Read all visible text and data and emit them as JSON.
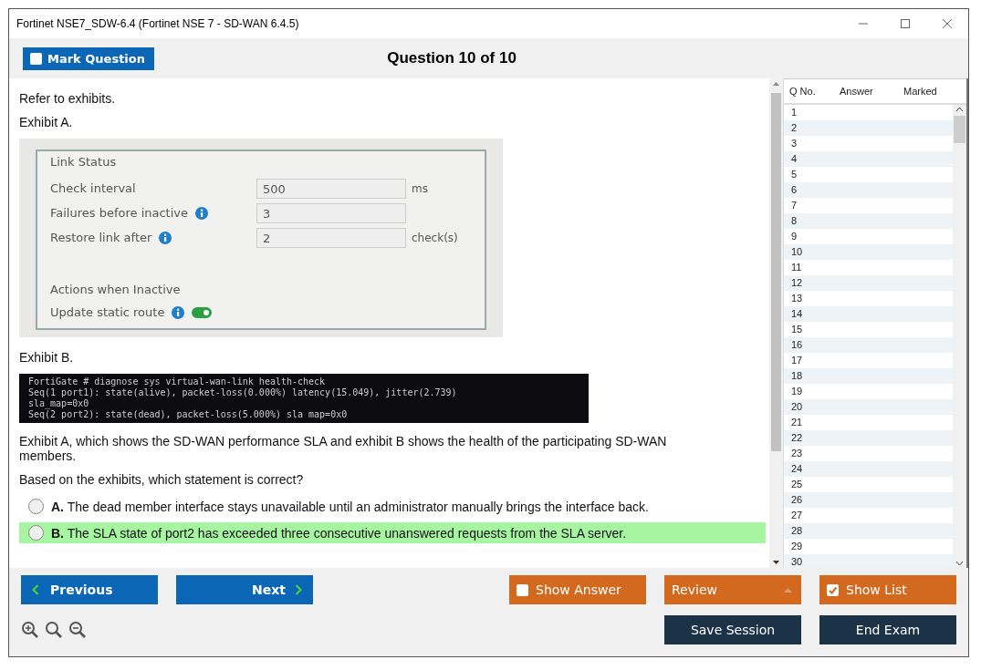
{
  "window": {
    "title": "Fortinet NSE7_SDW-6.4 (Fortinet NSE 7 - SD-WAN 6.4.5)"
  },
  "mark_question": {
    "label": "Mark Question",
    "checked": false
  },
  "header": "Question 10 of 10",
  "question": {
    "intro": "Refer to exhibits.",
    "exhibit_a_label": "Exhibit A.",
    "exhibit_a": {
      "title": "Link Status",
      "fields": [
        {
          "label": "Check interval",
          "info": false,
          "value": "500",
          "unit": "ms"
        },
        {
          "label": "Failures before inactive",
          "info": true,
          "value": "3"
        },
        {
          "label": "Restore link after",
          "info": true,
          "value": "2",
          "unit": "check(s)"
        }
      ],
      "section": "Actions when Inactive",
      "toggle": {
        "label": "Update static route",
        "info": true,
        "on": true
      }
    },
    "exhibit_b_label": "Exhibit B.",
    "terminal": [
      "FortiGate # diagnose sys virtual-wan-link health-check",
      "Seq(1 port1): state(alive), packet-loss(0.000%) latency(15.049), jitter(2.739)",
      "sla_map=0x0",
      "Seq(2 port2): state(dead), packet-loss(5.000%) sla map=0x0"
    ],
    "stem": "Exhibit A, which shows the SD-WAN performance SLA and exhibit B shows the health of the participating SD-WAN members.",
    "prompt": "Based on the exhibits, which statement is correct?",
    "options": [
      {
        "letter": "A.",
        "text": "The dead member interface stays unavailable until an administrator manually brings the interface back.",
        "selected": false,
        "correct": false
      },
      {
        "letter": "B.",
        "text": "The SLA state of port2 has exceeded three consecutive unanswered requests from the SLA server.",
        "selected": false,
        "correct": true
      }
    ]
  },
  "question_list": {
    "columns": [
      "Q No.",
      "Answer",
      "Marked"
    ],
    "rows": [
      "1",
      "2",
      "3",
      "4",
      "5",
      "6",
      "7",
      "8",
      "9",
      "10",
      "11",
      "12",
      "13",
      "14",
      "15",
      "16",
      "17",
      "18",
      "19",
      "20",
      "21",
      "22",
      "23",
      "24",
      "25",
      "26",
      "27",
      "28",
      "29",
      "30"
    ]
  },
  "nav": {
    "previous": "Previous",
    "next": "Next"
  },
  "show_answer": {
    "label": "Show Answer",
    "checked": false
  },
  "review": {
    "label": "Review"
  },
  "show_list": {
    "label": "Show List",
    "checked": true
  },
  "save_session": "Save Session",
  "end_exam": "End Exam"
}
